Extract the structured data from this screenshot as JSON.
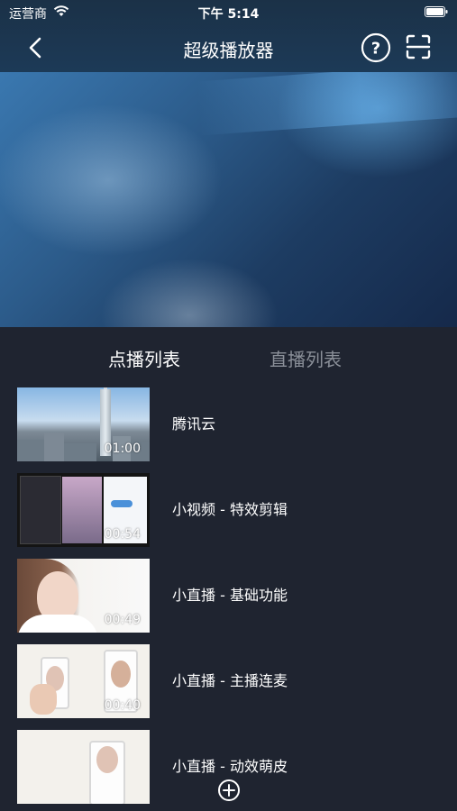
{
  "status_bar": {
    "carrier": "运营商",
    "time": "下午 5:14"
  },
  "nav": {
    "title": "超级播放器",
    "back_icon": "chevron-left-icon",
    "help_icon": "question-circle-icon",
    "scan_icon": "scan-icon"
  },
  "tabs": {
    "vod": "点播列表",
    "live": "直播列表",
    "active": "vod"
  },
  "videos": [
    {
      "title": "腾讯云",
      "duration": "01:00"
    },
    {
      "title": "小视频 - 特效剪辑",
      "duration": "00:54"
    },
    {
      "title": "小直播 - 基础功能",
      "duration": "00:49"
    },
    {
      "title": "小直播 - 主播连麦",
      "duration": "00:40"
    },
    {
      "title": "小直播 - 动效萌皮",
      "duration": ""
    }
  ],
  "add_button_icon": "plus-circle-icon",
  "colors": {
    "background": "#1f2430",
    "header": "#1c3a57",
    "tab_active": "#ffffff",
    "tab_inactive": "#8a8f98"
  }
}
